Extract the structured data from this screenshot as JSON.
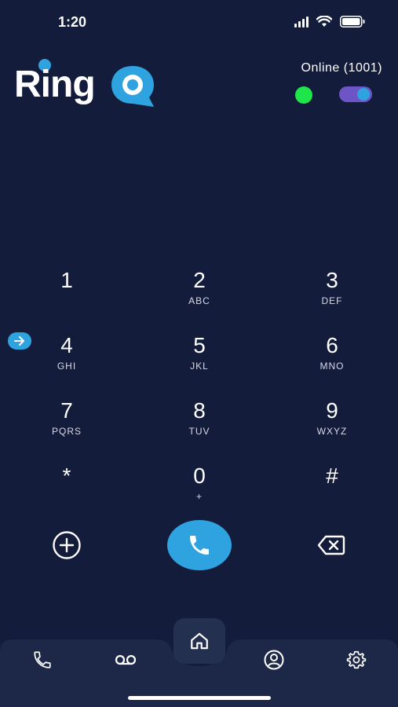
{
  "status_bar": {
    "time": "1:20"
  },
  "brand": {
    "logo_text": "Ring"
  },
  "presence": {
    "label": "Online  (1001)",
    "dot_color": "#1ee54a",
    "toggle_on": true
  },
  "dialpad": {
    "keys": [
      {
        "digit": "1",
        "letters": ""
      },
      {
        "digit": "2",
        "letters": "ABC"
      },
      {
        "digit": "3",
        "letters": "DEF"
      },
      {
        "digit": "4",
        "letters": "GHI"
      },
      {
        "digit": "5",
        "letters": "JKL"
      },
      {
        "digit": "6",
        "letters": "MNO"
      },
      {
        "digit": "7",
        "letters": "PQRS"
      },
      {
        "digit": "8",
        "letters": "TUV"
      },
      {
        "digit": "9",
        "letters": "WXYZ"
      },
      {
        "digit": "*",
        "letters": ""
      },
      {
        "digit": "0",
        "letters": "+"
      },
      {
        "digit": "#",
        "letters": ""
      }
    ]
  },
  "actions": {
    "add_icon": "plus-circle-icon",
    "call_icon": "phone-icon",
    "backspace_icon": "backspace-icon"
  },
  "nav": {
    "items": [
      {
        "icon": "phone-icon",
        "name": "calls"
      },
      {
        "icon": "voicemail-icon",
        "name": "voicemail"
      },
      {
        "icon": "home-icon",
        "name": "home"
      },
      {
        "icon": "account-icon",
        "name": "account"
      },
      {
        "icon": "gear-icon",
        "name": "settings"
      }
    ]
  },
  "colors": {
    "background": "#141c3b",
    "accent": "#2ea3e0",
    "toggle": "#6e55c7",
    "nav_surface": "#24304f"
  }
}
